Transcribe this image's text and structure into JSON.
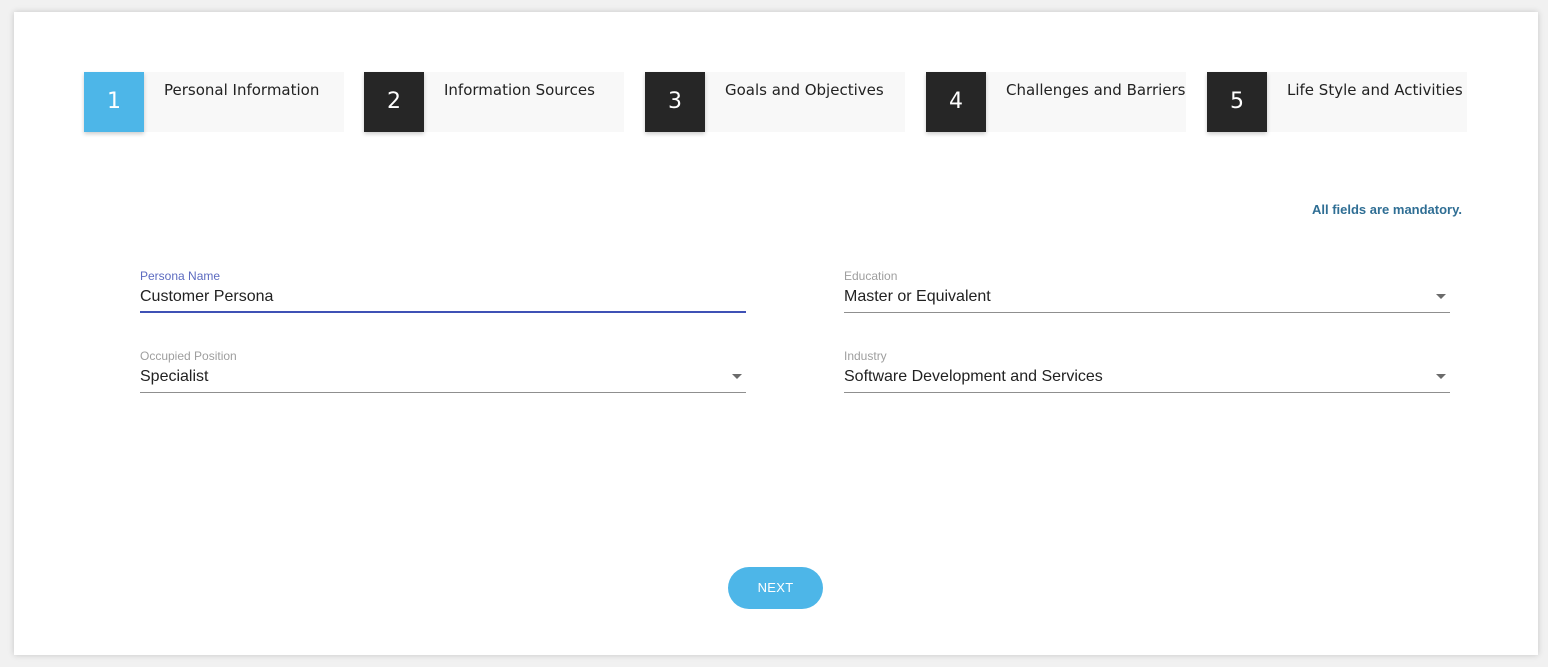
{
  "steps": [
    {
      "num": "1",
      "label": "Personal Information",
      "active": true
    },
    {
      "num": "2",
      "label": "Information Sources",
      "active": false
    },
    {
      "num": "3",
      "label": "Goals and Objectives",
      "active": false
    },
    {
      "num": "4",
      "label": "Challenges and Barriers",
      "active": false
    },
    {
      "num": "5",
      "label": "Life Style and Activities",
      "active": false
    }
  ],
  "form": {
    "mandatory_note": "All fields are mandatory.",
    "persona_name": {
      "label": "Persona Name",
      "value": "Customer Persona"
    },
    "education": {
      "label": "Education",
      "value": "Master or Equivalent"
    },
    "occupied_position": {
      "label": "Occupied Position",
      "value": "Specialist"
    },
    "industry": {
      "label": "Industry",
      "value": "Software Development and Services"
    }
  },
  "actions": {
    "next_label": "NEXT"
  },
  "colors": {
    "accent": "#4db6e8",
    "step_inactive": "#262626",
    "focus_line": "#3f51b5",
    "note": "#2f6e94"
  }
}
